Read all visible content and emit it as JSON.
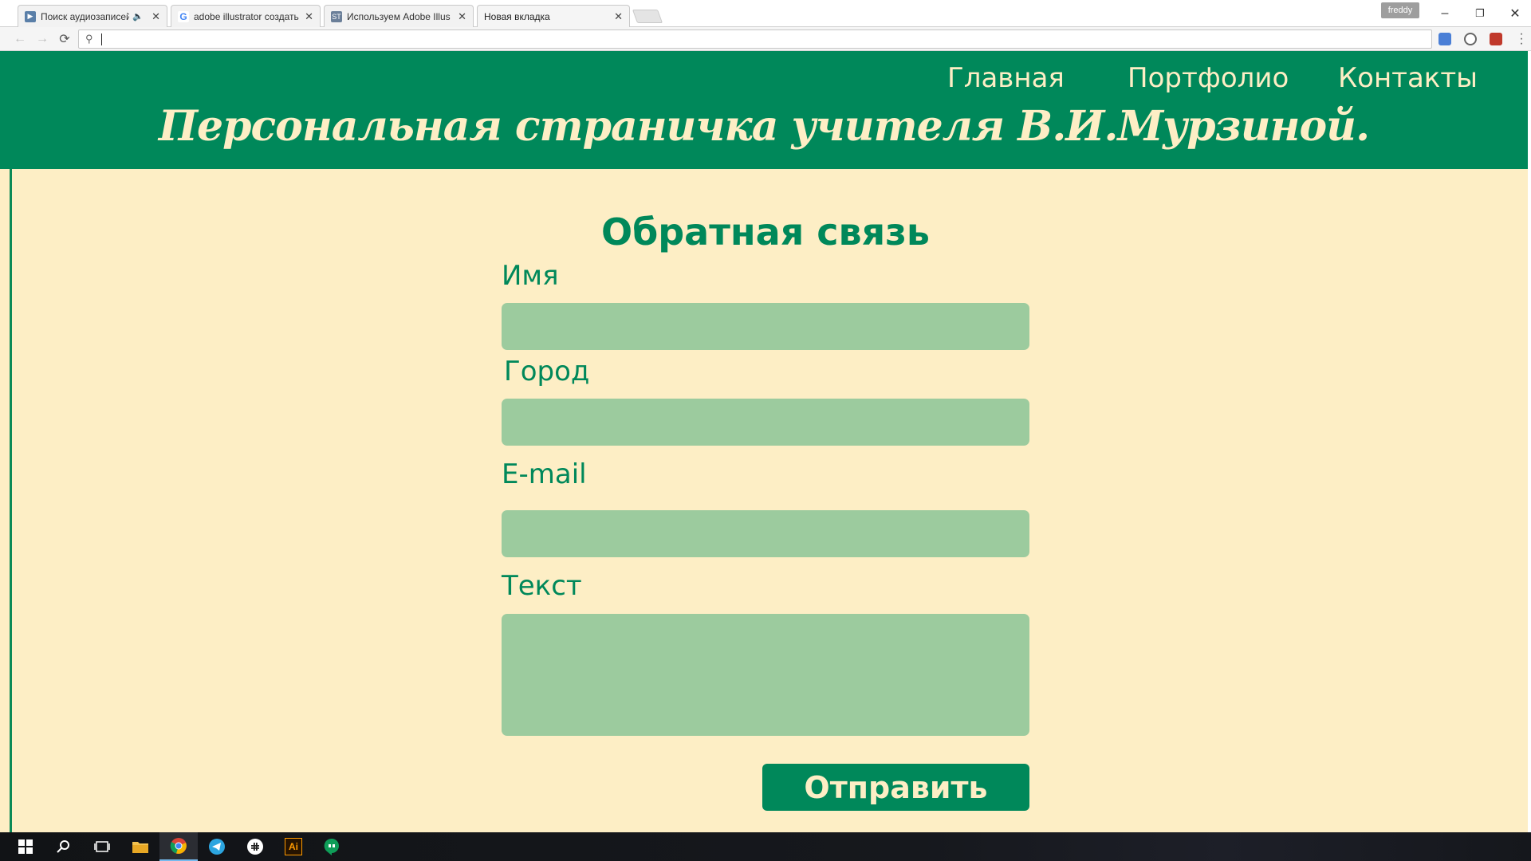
{
  "browser": {
    "tabs": [
      {
        "title": "Поиск аудиозаписей",
        "favicon": "play-icon",
        "audio": true,
        "active": false
      },
      {
        "title": "adobe illustrator создать",
        "favicon": "google-icon",
        "active": false
      },
      {
        "title": "Используем Adobe Illus",
        "favicon": "st-icon",
        "favicon_text": "ST",
        "active": false
      },
      {
        "title": "Новая вкладка",
        "favicon": "none",
        "active": true
      }
    ],
    "user_name": "freddy",
    "address_value": "",
    "window_controls": {
      "minimize": "–",
      "restore": "❐",
      "close": "✕"
    },
    "nav_icons": {
      "back": "←",
      "forward": "→",
      "reload": "⟳",
      "search": "⚲"
    }
  },
  "site": {
    "nav": {
      "home": "Главная",
      "portfolio": "Портфолио",
      "contacts": "Контакты"
    },
    "title": "Персональная страничка учителя В.И.Мурзиной."
  },
  "form": {
    "heading": "Обратная связь",
    "name_label": "Имя",
    "city_label": "Город",
    "email_label": "E-mail",
    "text_label": "Текст",
    "name_value": "",
    "city_value": "",
    "email_value": "",
    "text_value": "",
    "submit_label": "Отправить"
  },
  "taskbar": {
    "items": [
      "windows-start-icon",
      "search-icon",
      "task-view-icon",
      "file-explorer-icon",
      "chrome-icon",
      "telegram-icon",
      "slack-icon",
      "illustrator-icon",
      "hangouts-icon"
    ],
    "illustrator_text": "Ai"
  },
  "colors": {
    "brand_green": "#00885a",
    "cream": "#fdeec5",
    "input_green": "#9ccb9e"
  }
}
